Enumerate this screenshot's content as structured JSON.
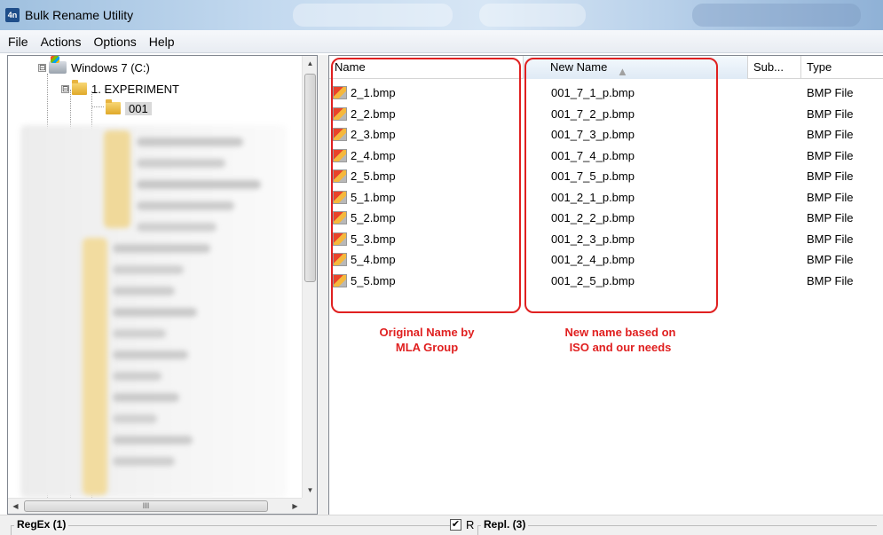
{
  "window": {
    "title": "Bulk Rename Utility",
    "icon_name": "bulk-rename-app-icon",
    "icon_text": "4n"
  },
  "menu": [
    "File",
    "Actions",
    "Options",
    "Help"
  ],
  "tree": {
    "drive_label": "Windows 7 (C:)",
    "items": [
      {
        "label": "1. EXPERIMENT",
        "expander": "⊟"
      },
      {
        "label": "001"
      }
    ],
    "drive_expander": "⊟",
    "hscroll_grip": "III"
  },
  "file_list": {
    "columns": [
      {
        "label": "Name"
      },
      {
        "label": "New Name",
        "sorted": true
      },
      {
        "label": "Sub..."
      },
      {
        "label": "Type"
      }
    ],
    "rows": [
      {
        "name": "2_1.bmp",
        "new_name": "001_7_1_p.bmp",
        "type": "BMP File"
      },
      {
        "name": "2_2.bmp",
        "new_name": "001_7_2_p.bmp",
        "type": "BMP File"
      },
      {
        "name": "2_3.bmp",
        "new_name": "001_7_3_p.bmp",
        "type": "BMP File"
      },
      {
        "name": "2_4.bmp",
        "new_name": "001_7_4_p.bmp",
        "type": "BMP File"
      },
      {
        "name": "2_5.bmp",
        "new_name": "001_7_5_p.bmp",
        "type": "BMP File"
      },
      {
        "name": "5_1.bmp",
        "new_name": "001_2_1_p.bmp",
        "type": "BMP File"
      },
      {
        "name": "5_2.bmp",
        "new_name": "001_2_2_p.bmp",
        "type": "BMP File"
      },
      {
        "name": "5_3.bmp",
        "new_name": "001_2_3_p.bmp",
        "type": "BMP File"
      },
      {
        "name": "5_4.bmp",
        "new_name": "001_2_4_p.bmp",
        "type": "BMP File"
      },
      {
        "name": "5_5.bmp",
        "new_name": "001_2_5_p.bmp",
        "type": "BMP File"
      }
    ],
    "sort_indicator": "▲"
  },
  "annotations": {
    "original": "Original Name by\nMLA Group",
    "new": "New name based on\nISO and our needs",
    "color": "#e02020"
  },
  "bottom": {
    "regex_label": "RegEx (1)",
    "checkbox_mark": "✔",
    "r_label": "R",
    "repl_label": "Repl. (3)"
  }
}
